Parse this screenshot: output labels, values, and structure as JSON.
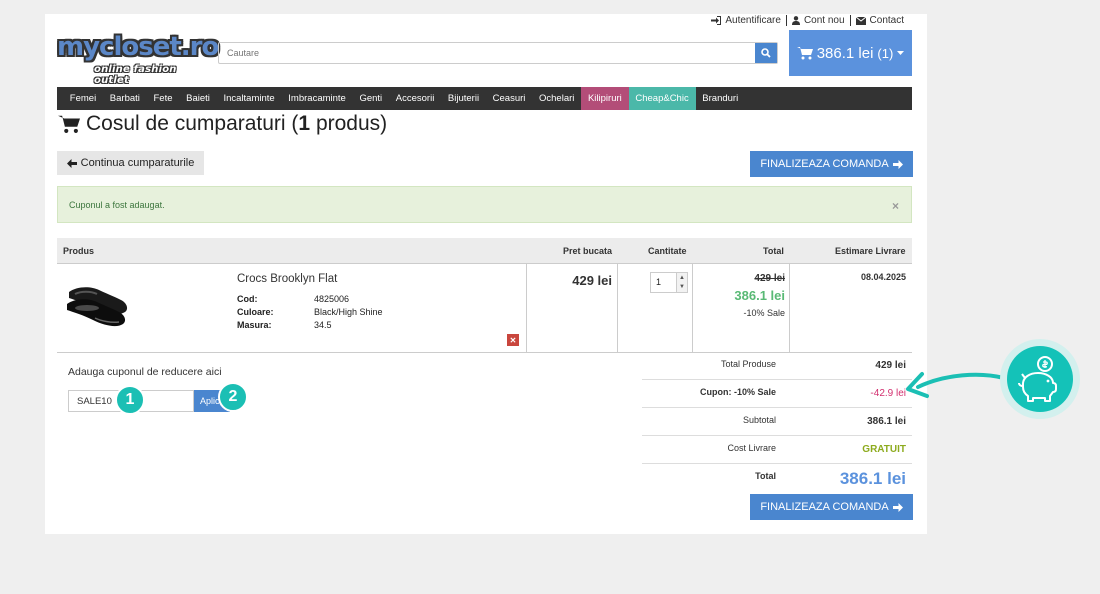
{
  "top_links": {
    "login": "Autentificare",
    "account": "Cont nou",
    "contact": "Contact"
  },
  "logo": {
    "main": "mycloset.ro",
    "sub": "online fashion outlet"
  },
  "search": {
    "placeholder": "Cautare"
  },
  "cart": {
    "total": "386.1 lei",
    "count": "(1)"
  },
  "nav": [
    "Femei",
    "Barbati",
    "Fete",
    "Baieti",
    "Incaltaminte",
    "Imbracaminte",
    "Genti",
    "Accesorii",
    "Bijuterii",
    "Ceasuri",
    "Ochelari",
    "Kilipiruri",
    "Cheap&Chic",
    "Branduri"
  ],
  "page": {
    "title_prefix": "Cosul de cumparaturi (",
    "title_count": "1",
    "title_suffix": " produs)",
    "continue": "Continua cumparaturile",
    "finalize": "FINALIZEAZA COMANDA"
  },
  "alert": {
    "message": "Cuponul a fost adaugat.",
    "close": "×"
  },
  "table": {
    "headers": {
      "product": "Produs",
      "unit_price": "Pret bucata",
      "quantity": "Cantitate",
      "total": "Total",
      "delivery": "Estimare Livrare"
    },
    "item": {
      "name": "Crocs Brooklyn Flat",
      "attrs": [
        {
          "key": "Cod:",
          "value": "4825006"
        },
        {
          "key": "Culoare:",
          "value": "Black/High Shine"
        },
        {
          "key": "Masura:",
          "value": "34.5"
        }
      ],
      "unit_price": "429 lei",
      "quantity": "1",
      "old_total": "429 lei",
      "new_total": "386.1 lei",
      "discount": "-10% Sale",
      "delivery_date": "08.04.2025"
    }
  },
  "coupon": {
    "label": "Adauga cuponul de reducere aici",
    "code": "SALE10",
    "apply": "Aplica",
    "step1": "1",
    "step2": "2"
  },
  "totals": [
    {
      "label": "Total Produse",
      "value": "429 lei"
    },
    {
      "label": "Cupon: -10% Sale",
      "value": "-42.9 lei"
    },
    {
      "label": "Subtotal",
      "value": "386.1 lei"
    },
    {
      "label": "Cost Livrare",
      "value": "GRATUIT"
    },
    {
      "label": "Total",
      "value": "386.1 lei"
    }
  ],
  "colors": {
    "accent": "#4a86cf",
    "discount": "#d2306f",
    "free": "#8dab1e",
    "sale_price": "#59b975",
    "teal": "#1bbfb4"
  }
}
